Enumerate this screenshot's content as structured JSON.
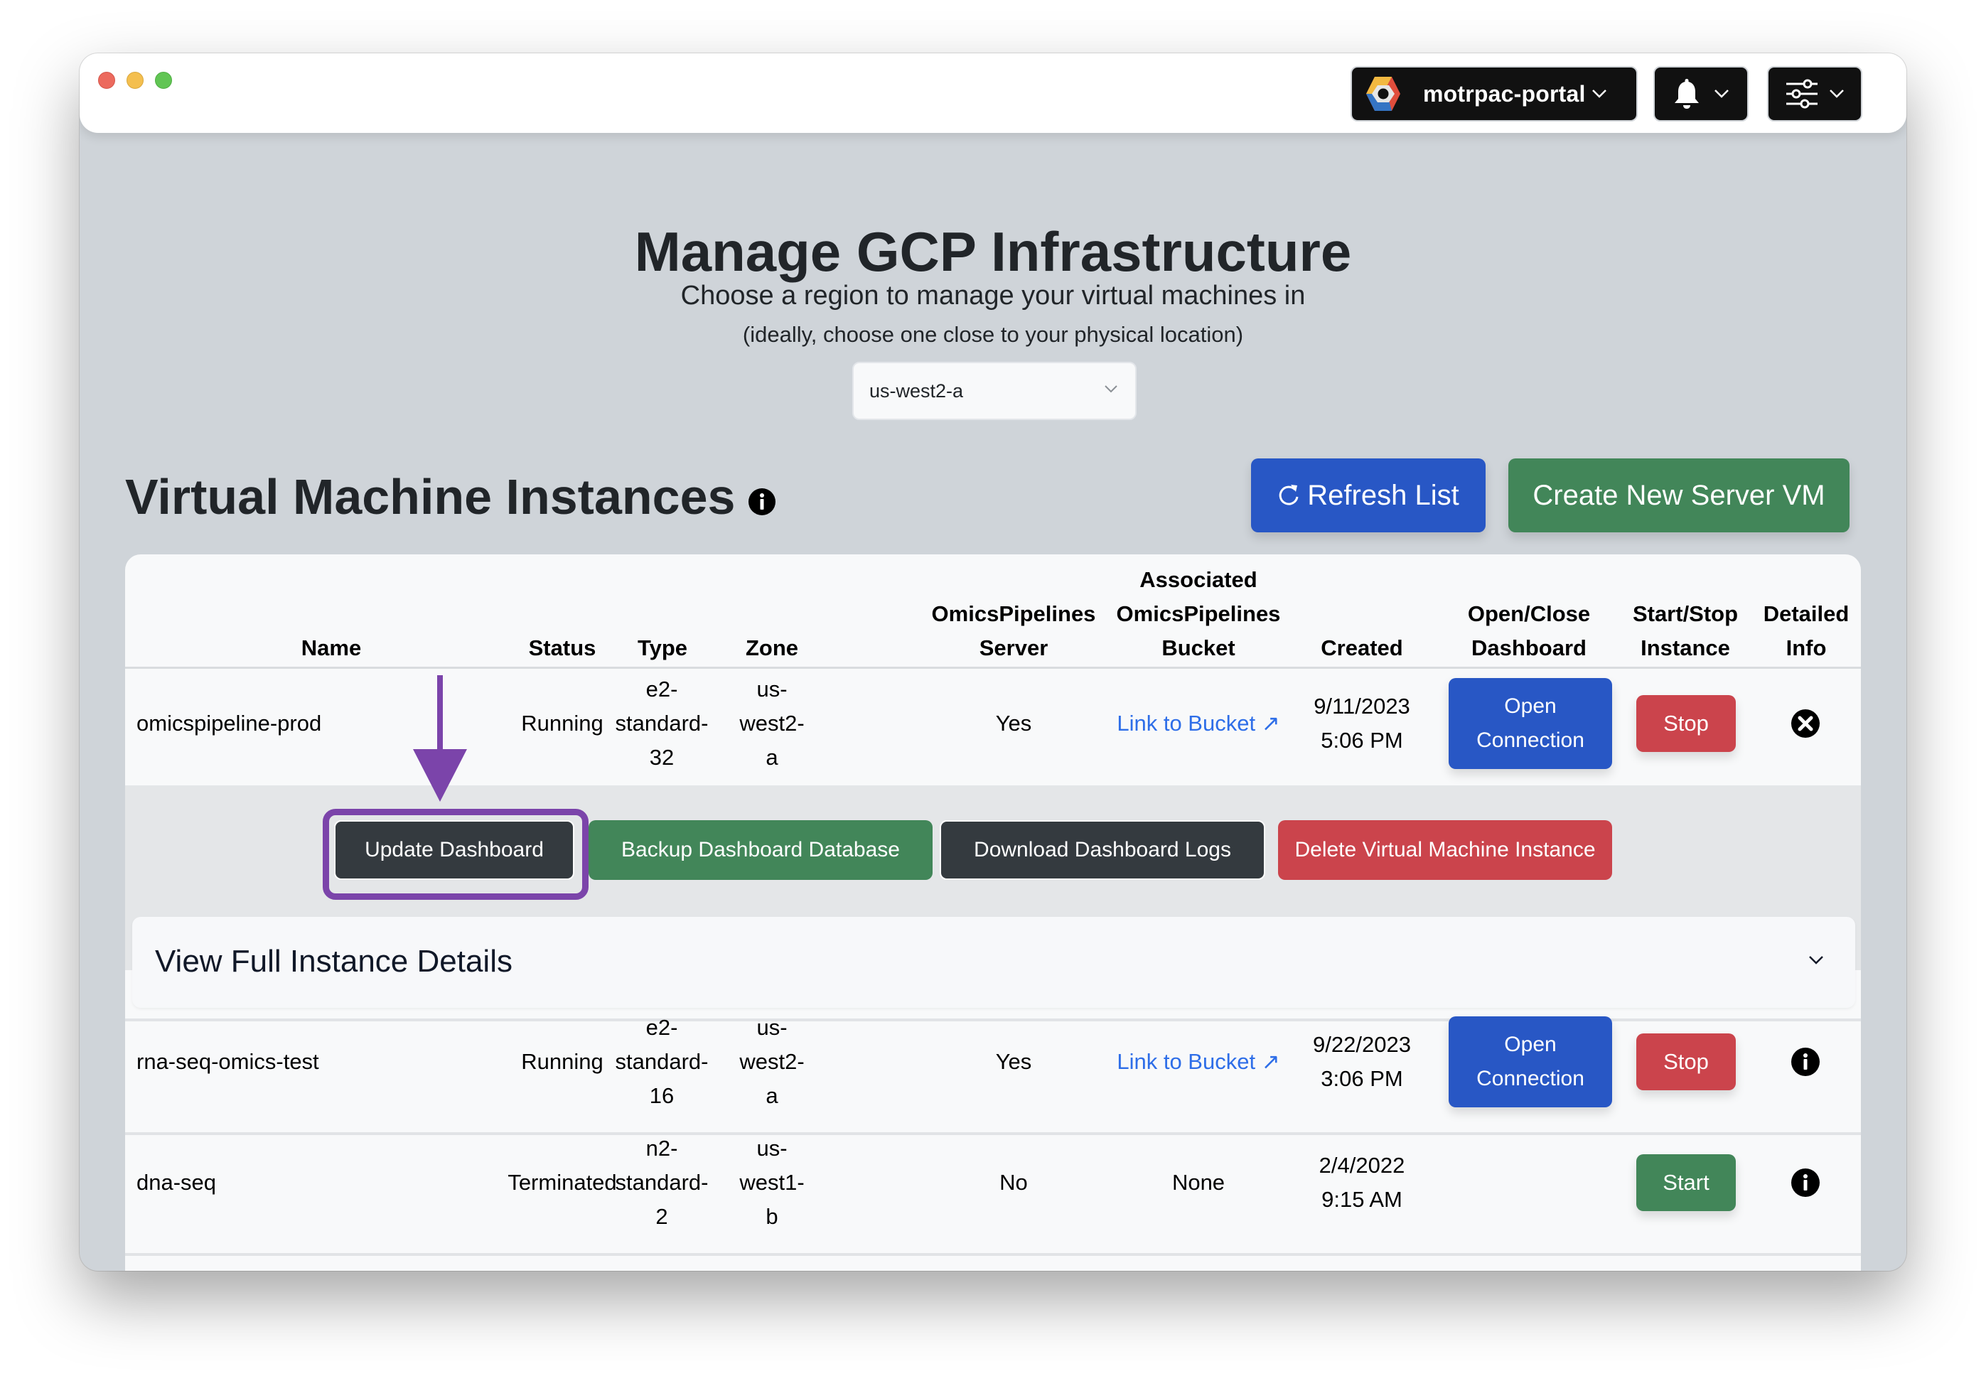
{
  "window": {
    "traffic_lights": [
      "close",
      "minimize",
      "zoom"
    ]
  },
  "navbar": {
    "project": {
      "icon": "gcp-hexagon-icon",
      "label": "motrpac-portal"
    },
    "notifications": {
      "icon": "bell-icon"
    },
    "settings": {
      "icon": "sliders-icon"
    }
  },
  "page": {
    "title": "Manage GCP Infrastructure",
    "region_prompt": "Choose a region to manage your virtual machines in",
    "region_hint": "(ideally, choose one close to your physical location)",
    "region_select": {
      "value": "us-west2-a"
    }
  },
  "instances": {
    "title": "Virtual Machine Instances",
    "info_icon": "info-circle-icon",
    "refresh_label": "Refresh List",
    "refresh_icon": "refresh-icon",
    "create_label": "Create New Server VM",
    "columns": [
      {
        "key": "name",
        "lines": [
          "Name"
        ]
      },
      {
        "key": "status",
        "lines": [
          "Status"
        ]
      },
      {
        "key": "type",
        "lines": [
          "Type"
        ]
      },
      {
        "key": "zone",
        "lines": [
          "Zone"
        ]
      },
      {
        "key": "server",
        "lines": [
          "OmicsPipelines",
          "Server"
        ]
      },
      {
        "key": "bucket",
        "lines": [
          "Associated",
          "OmicsPipelines",
          "Bucket"
        ]
      },
      {
        "key": "created",
        "lines": [
          "Created"
        ]
      },
      {
        "key": "dashboard",
        "lines": [
          "Open/Close",
          "Dashboard"
        ]
      },
      {
        "key": "startstop",
        "lines": [
          "Start/Stop",
          "Instance"
        ]
      },
      {
        "key": "info",
        "lines": [
          "Detailed",
          "Info"
        ]
      }
    ],
    "rows": [
      {
        "name": "omicspipeline-prod",
        "status": "Running",
        "type": [
          "e2-",
          "standard-",
          "32"
        ],
        "zone": [
          "us-",
          "west2-",
          "a"
        ],
        "server": "Yes",
        "bucket": "Link to Bucket ↗",
        "created": [
          "9/11/2023",
          "5:06 PM"
        ],
        "dashboard": [
          "Open",
          "Connection"
        ],
        "startstop": "Stop",
        "info_icon": "close-circle-icon",
        "expanded": true
      },
      {
        "name": "rna-seq-omics-test",
        "status": "Running",
        "type": [
          "e2-",
          "standard-",
          "16"
        ],
        "zone": [
          "us-",
          "west2-",
          "a"
        ],
        "server": "Yes",
        "bucket": "Link to Bucket ↗",
        "created": [
          "9/22/2023",
          "3:06 PM"
        ],
        "dashboard": [
          "Open",
          "Connection"
        ],
        "startstop": "Stop",
        "info_icon": "info-circle-icon",
        "expanded": false
      },
      {
        "name": "dna-seq",
        "status": "Terminated",
        "type": [
          "n2-",
          "standard-",
          "2"
        ],
        "zone": [
          "us-",
          "west1-",
          "b"
        ],
        "server": "No",
        "bucket": "None",
        "created": [
          "2/4/2022",
          "9:15 AM"
        ],
        "dashboard": null,
        "startstop": "Start",
        "info_icon": "info-circle-icon",
        "expanded": false
      }
    ],
    "expanded_actions": {
      "update": "Update Dashboard",
      "backup": "Backup Dashboard Database",
      "logs": "Download Dashboard Logs",
      "delete": "Delete Virtual Machine Instance"
    },
    "details_toggle": "View Full Instance Details"
  },
  "annotation": {
    "arrow_color": "#7b44aa",
    "highlight_target": "Update Dashboard"
  },
  "colors": {
    "primary": "#2857c5",
    "success": "#428659",
    "danger": "#cb444c",
    "dark": "#343a3f",
    "link": "#2e6ee8",
    "page_bg": "#cfd4d9"
  }
}
